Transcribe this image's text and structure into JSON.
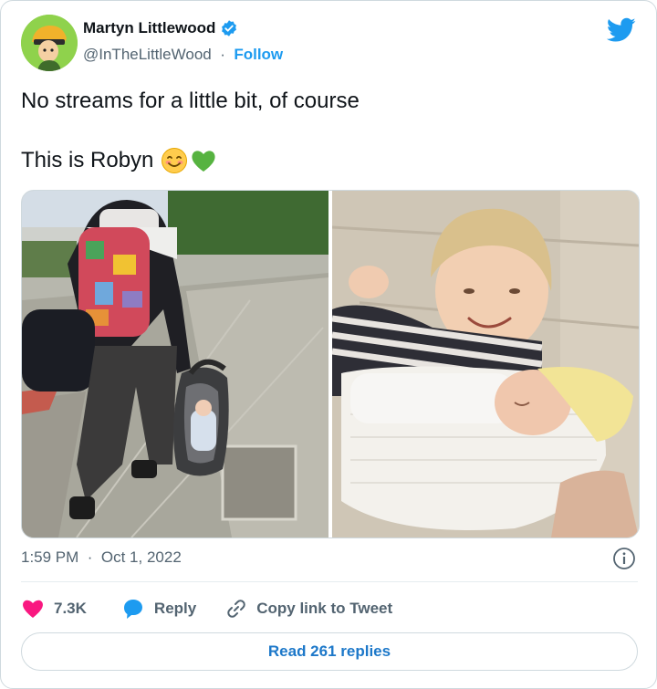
{
  "author": {
    "name": "Martyn Littlewood",
    "handle": "@InTheLittleWood",
    "separator": "·",
    "follow_label": "Follow"
  },
  "tweet": {
    "line1": "No streams for a little bit, of course",
    "line2": "This is Robyn"
  },
  "meta": {
    "time": "1:59 PM",
    "separator": "·",
    "date": "Oct 1, 2022"
  },
  "actions": {
    "like_count": "7.3K",
    "reply_label": "Reply",
    "copy_label": "Copy link to Tweet"
  },
  "read_replies_label": "Read 261 replies",
  "colors": {
    "brand_blue": "#1d9bf0",
    "like_pink": "#f91880",
    "text_primary": "#0f1419",
    "text_secondary": "#536471"
  },
  "icons": {
    "verified": "verified-badge-icon",
    "bird": "twitter-bird-icon",
    "emoji_smile": "smiling-face-emoji-icon",
    "emoji_heart": "green-heart-emoji-icon",
    "info": "info-icon",
    "like": "heart-icon",
    "reply": "speech-bubble-icon",
    "link": "link-icon"
  }
}
